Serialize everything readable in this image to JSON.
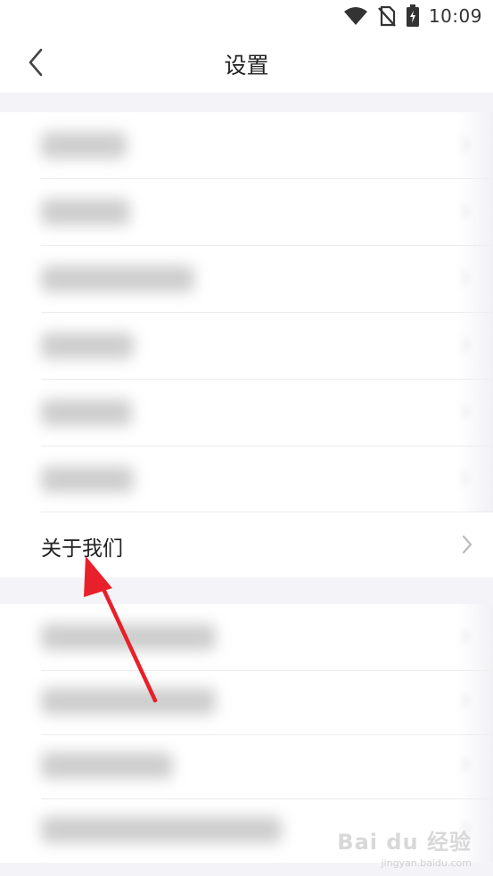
{
  "status_bar": {
    "time": "10:09",
    "icons": [
      "wifi-icon",
      "no-sim-icon",
      "battery-charging-icon"
    ]
  },
  "nav": {
    "title": "设置",
    "back_icon": "chevron-left-icon"
  },
  "groups": {
    "first_blurred_rows": 6,
    "second_blurred_rows": 4
  },
  "about_row": {
    "label": "关于我们",
    "chevron_icon": "chevron-right-icon"
  },
  "annotation": {
    "arrow_color": "#e8202a"
  },
  "watermark": {
    "logo": "Bai du 经验",
    "sub": "jingyan.baidu.com"
  },
  "colors": {
    "background": "#ffffff",
    "section_gap": "#f4f4f8",
    "text": "#222222",
    "chevron": "#bbbbbb"
  }
}
